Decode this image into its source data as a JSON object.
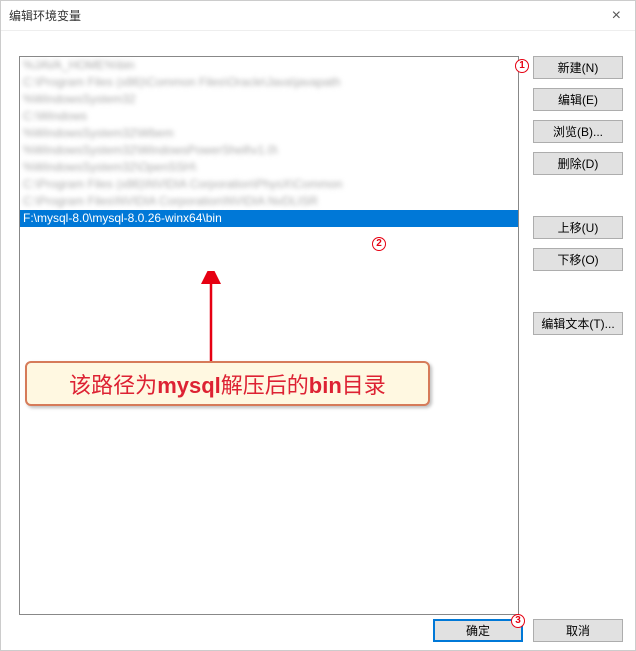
{
  "window": {
    "title": "编辑环境变量",
    "close_label": "×"
  },
  "list": {
    "blurred": [
      "%JAVA_HOME%\\bin",
      "C:\\Program Files (x86)\\Common Files\\Oracle\\Java\\javapath",
      "%WindowsSystem32",
      "C:\\Windows",
      "%WindowsSystem32\\Wbem",
      "%WindowsSystem32\\WindowsPowerShell\\v1.0\\",
      "%WindowsSystem32\\OpenSSH\\",
      "C:\\Program Files (x86)\\NVIDIA Corporation\\PhysX\\Common",
      "C:\\Program Files\\NVIDIA Corporation\\NVIDIA NvDLISR"
    ],
    "selected": "F:\\mysql-8.0\\mysql-8.0.26-winx64\\bin"
  },
  "buttons": {
    "new": "新建(N)",
    "edit": "编辑(E)",
    "browse": "浏览(B)...",
    "delete": "删除(D)",
    "move_up": "上移(U)",
    "move_down": "下移(O)",
    "edit_text": "编辑文本(T)...",
    "ok": "确定",
    "cancel": "取消"
  },
  "callout": {
    "prefix": "该路径为",
    "mid1": "mysql",
    "mid2": "解压后的",
    "mid3": "bin",
    "suffix": "目录"
  },
  "badges": {
    "b1": "1",
    "b2": "2",
    "b3": "3"
  }
}
